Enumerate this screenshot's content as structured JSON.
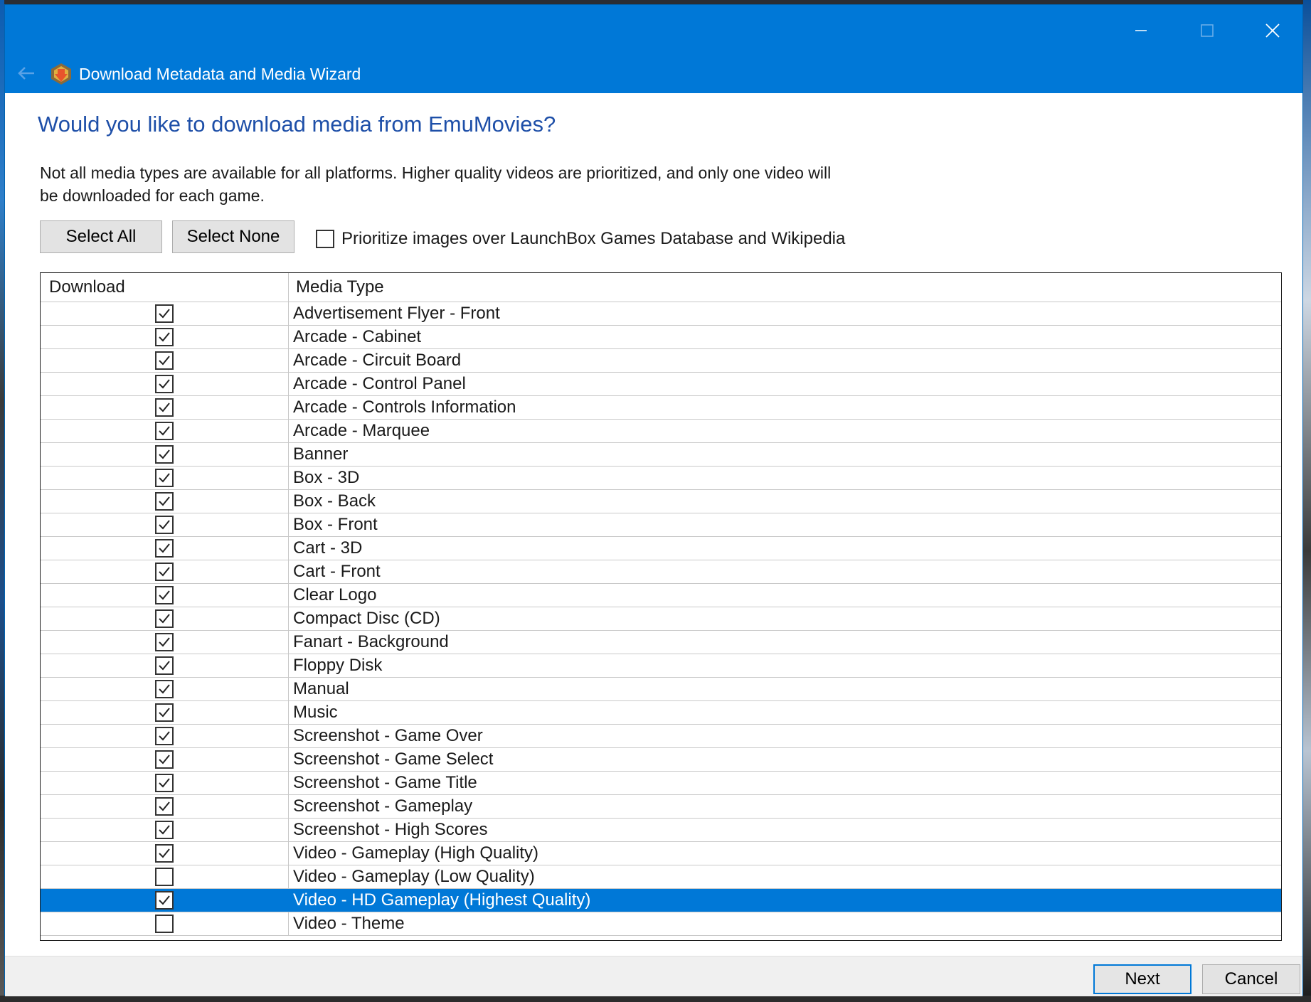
{
  "window": {
    "title": "Download Metadata and Media Wizard"
  },
  "page": {
    "heading": "Would you like to download media from EmuMovies?",
    "description": "Not all media types are available for all platforms. Higher quality videos are prioritized, and only one video will be downloaded for each game."
  },
  "toolbar": {
    "select_all": "Select All",
    "select_none": "Select None",
    "prioritize_label": "Prioritize images over LaunchBox Games Database and Wikipedia",
    "prioritize_checked": false
  },
  "grid": {
    "columns": [
      "Download",
      "Media Type"
    ],
    "rows": [
      {
        "checked": true,
        "media": "Advertisement Flyer - Front"
      },
      {
        "checked": true,
        "media": "Arcade - Cabinet"
      },
      {
        "checked": true,
        "media": "Arcade - Circuit Board"
      },
      {
        "checked": true,
        "media": "Arcade - Control Panel"
      },
      {
        "checked": true,
        "media": "Arcade - Controls Information"
      },
      {
        "checked": true,
        "media": "Arcade - Marquee"
      },
      {
        "checked": true,
        "media": "Banner"
      },
      {
        "checked": true,
        "media": "Box - 3D"
      },
      {
        "checked": true,
        "media": "Box - Back"
      },
      {
        "checked": true,
        "media": "Box - Front"
      },
      {
        "checked": true,
        "media": "Cart - 3D"
      },
      {
        "checked": true,
        "media": "Cart - Front"
      },
      {
        "checked": true,
        "media": "Clear Logo"
      },
      {
        "checked": true,
        "media": "Compact Disc (CD)"
      },
      {
        "checked": true,
        "media": "Fanart - Background"
      },
      {
        "checked": true,
        "media": "Floppy Disk"
      },
      {
        "checked": true,
        "media": "Manual"
      },
      {
        "checked": true,
        "media": "Music"
      },
      {
        "checked": true,
        "media": "Screenshot - Game Over"
      },
      {
        "checked": true,
        "media": "Screenshot - Game Select"
      },
      {
        "checked": true,
        "media": "Screenshot - Game Title"
      },
      {
        "checked": true,
        "media": "Screenshot - Gameplay"
      },
      {
        "checked": true,
        "media": "Screenshot - High Scores"
      },
      {
        "checked": true,
        "media": "Video - Gameplay (High Quality)"
      },
      {
        "checked": false,
        "media": "Video - Gameplay (Low Quality)"
      },
      {
        "checked": true,
        "media": "Video - HD Gameplay (Highest Quality)",
        "selected": true
      },
      {
        "checked": false,
        "media": "Video - Theme"
      }
    ]
  },
  "footer": {
    "next": "Next",
    "cancel": "Cancel"
  },
  "colors": {
    "accent": "#0078d7",
    "heading": "#1e4fa8"
  }
}
